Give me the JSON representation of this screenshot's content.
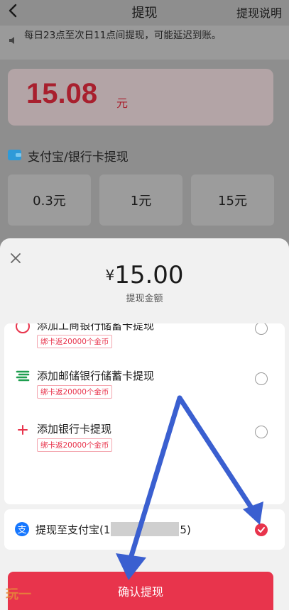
{
  "header": {
    "title": "提现",
    "help_link": "提现说明"
  },
  "notice": {
    "text": "每日23点至次日11点间提现，可能延迟到账。"
  },
  "balance": {
    "amount": "15.08",
    "unit": "元"
  },
  "section": {
    "title": "支付宝/银行卡提现"
  },
  "amount_options": [
    {
      "label": "0.3元"
    },
    {
      "label": "1元"
    },
    {
      "label": "15元"
    }
  ],
  "sheet": {
    "currency": "¥",
    "amount": "15.00",
    "amount_label": "提现金额",
    "methods": [
      {
        "name": "添加工商银行储蓄卡提现",
        "badge": "绑卡返20000个金币",
        "icon": "bank-card-icon"
      },
      {
        "name": "添加邮储银行储蓄卡提现",
        "badge": "绑卡返20000个金币",
        "icon": "psbc-icon"
      },
      {
        "name": "添加银行卡提现",
        "badge": "绑卡返20000个金币",
        "icon": "plus-icon"
      }
    ],
    "alipay": {
      "prefix": "提现至支付宝(1",
      "suffix": "5)",
      "selected": true,
      "icon": "alipay-icon"
    },
    "confirm_label": "确认提现"
  },
  "watermark": {
    "text": "玩一"
  },
  "colors": {
    "accent": "#e8344c",
    "balance_red": "#a8202e",
    "arrow_blue": "#3a5fd0",
    "psbc_green": "#1e9e4f",
    "wallet_blue": "#2f9ad8"
  }
}
